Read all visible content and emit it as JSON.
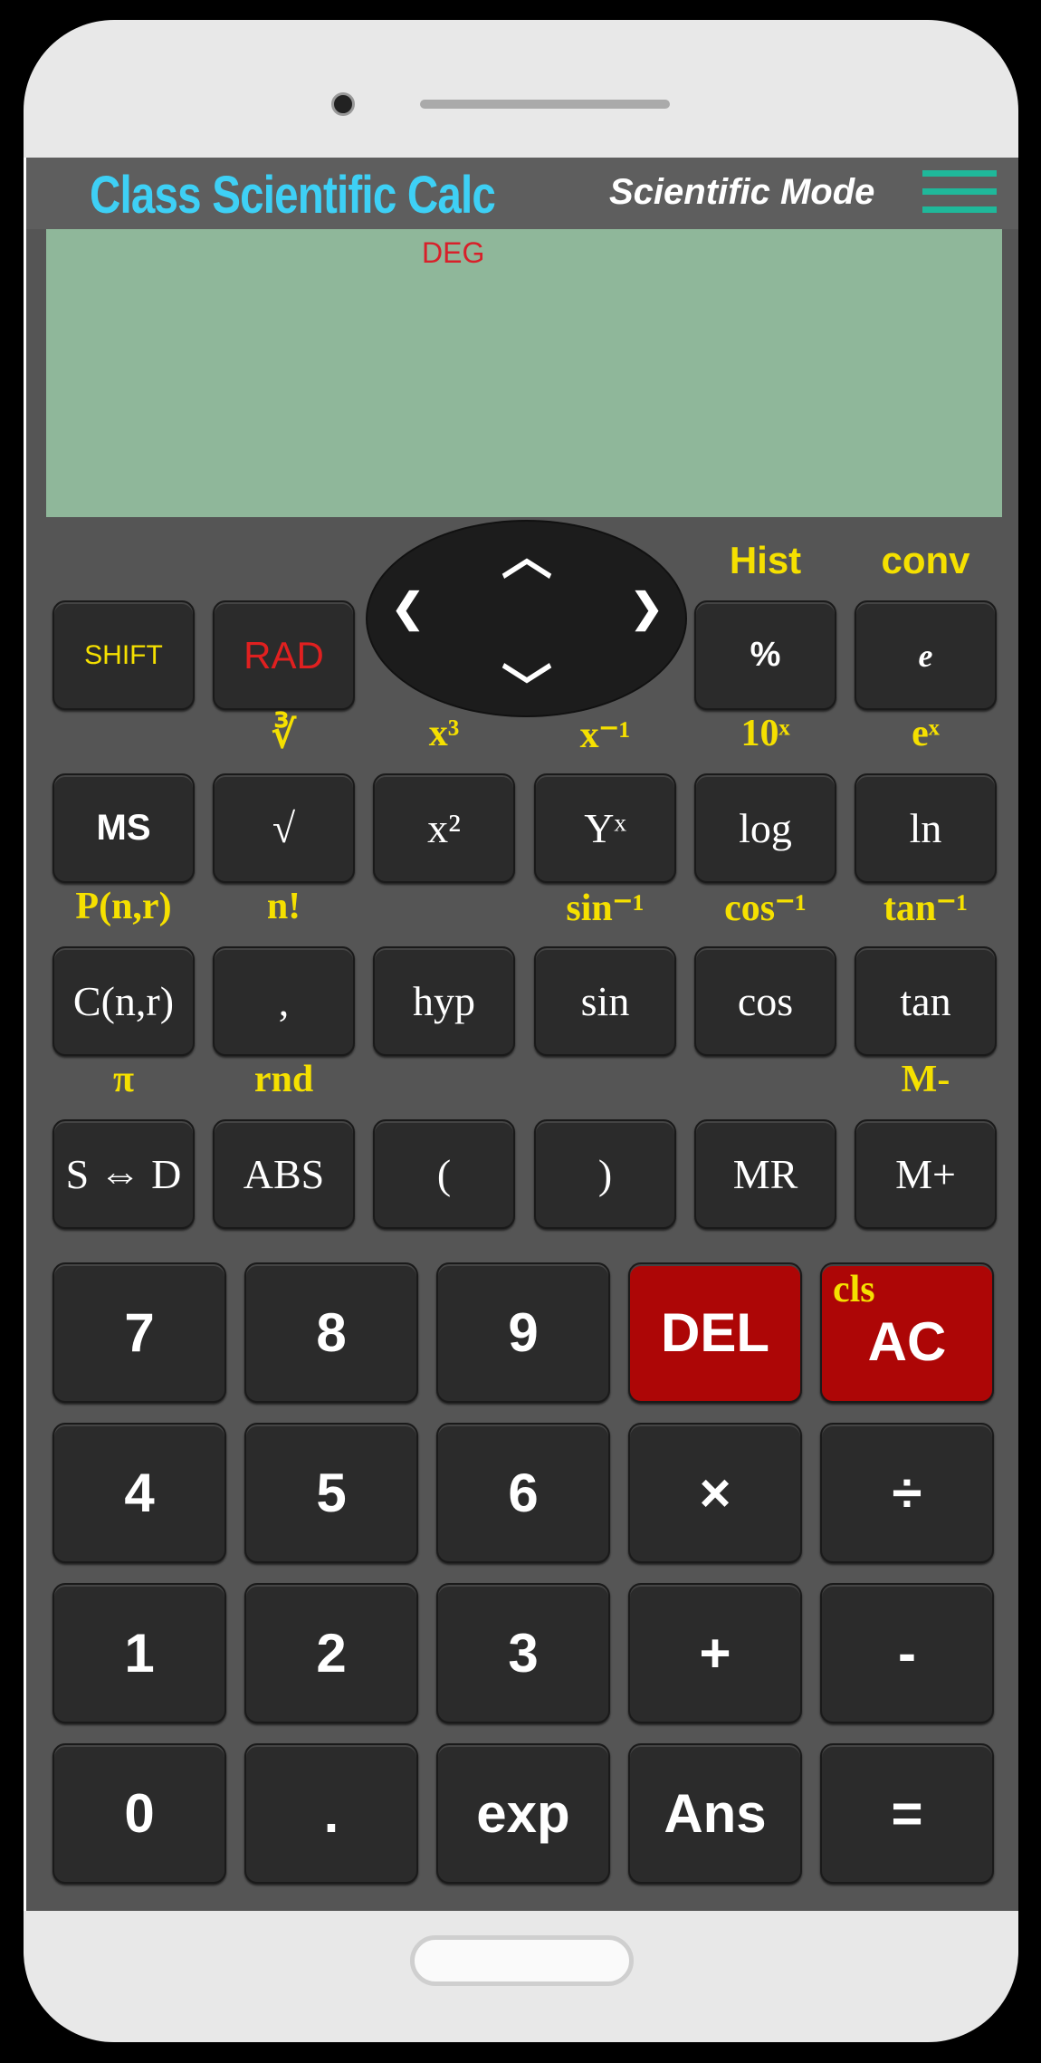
{
  "header": {
    "title": "Class Scientific Calc",
    "mode": "Scientific Mode"
  },
  "display": {
    "angle_mode": "DEG",
    "value": ""
  },
  "colors": {
    "accent_title": "#3ed0f5",
    "shift_label": "#f5e000",
    "display_bg": "#8fb79a",
    "danger_key": "#ad0606",
    "menu": "#1fb89a"
  },
  "dpad": {
    "up": "︿",
    "down": "﹀",
    "left": "❮",
    "right": "❯"
  },
  "sci_rows": [
    [
      {
        "label": "SHIFT",
        "shift": "",
        "col": 0,
        "style": "shift"
      },
      {
        "label": "RAD",
        "shift": "",
        "col": 1,
        "style": "rad"
      },
      {
        "label": "%",
        "shift": "Hist",
        "col": 4,
        "style": "sans"
      },
      {
        "label": "e",
        "shift": "conv",
        "col": 5,
        "style": "ital"
      }
    ],
    [
      {
        "label": "MS",
        "shift": "",
        "col": 0,
        "style": "sansb"
      },
      {
        "label": "√",
        "shift": "∛",
        "col": 1
      },
      {
        "label": "x²",
        "shift": "x³",
        "col": 2
      },
      {
        "label": "Yˣ",
        "shift": "x⁻¹",
        "col": 3
      },
      {
        "label": "log",
        "shift": "10ˣ",
        "col": 4
      },
      {
        "label": "ln",
        "shift": "eˣ",
        "col": 5
      }
    ],
    [
      {
        "label": "C(n,r)",
        "shift": "P(n,r)",
        "col": 0
      },
      {
        "label": ",",
        "shift": "n!",
        "col": 1
      },
      {
        "label": "hyp",
        "shift": "",
        "col": 2
      },
      {
        "label": "sin",
        "shift": "sin⁻¹",
        "col": 3
      },
      {
        "label": "cos",
        "shift": "cos⁻¹",
        "col": 4
      },
      {
        "label": "tan",
        "shift": "tan⁻¹",
        "col": 5
      }
    ],
    [
      {
        "label": "S ⇔ D",
        "shift": "π",
        "col": 0
      },
      {
        "label": "ABS",
        "shift": "rnd",
        "col": 1
      },
      {
        "label": "(",
        "shift": "",
        "col": 2
      },
      {
        "label": ")",
        "shift": "",
        "col": 3
      },
      {
        "label": "MR",
        "shift": "",
        "col": 4
      },
      {
        "label": "M+",
        "shift": "M-",
        "col": 5
      }
    ]
  ],
  "num_rows": [
    [
      {
        "label": "7"
      },
      {
        "label": "8"
      },
      {
        "label": "9"
      },
      {
        "label": "DEL",
        "style": "red"
      },
      {
        "label": "AC",
        "shift": "cls",
        "style": "red"
      }
    ],
    [
      {
        "label": "4"
      },
      {
        "label": "5"
      },
      {
        "label": "6"
      },
      {
        "label": "×"
      },
      {
        "label": "÷"
      }
    ],
    [
      {
        "label": "1"
      },
      {
        "label": "2"
      },
      {
        "label": "3"
      },
      {
        "label": "+"
      },
      {
        "label": "-"
      }
    ],
    [
      {
        "label": "0"
      },
      {
        "label": "."
      },
      {
        "label": "exp"
      },
      {
        "label": "Ans"
      },
      {
        "label": "="
      }
    ]
  ]
}
